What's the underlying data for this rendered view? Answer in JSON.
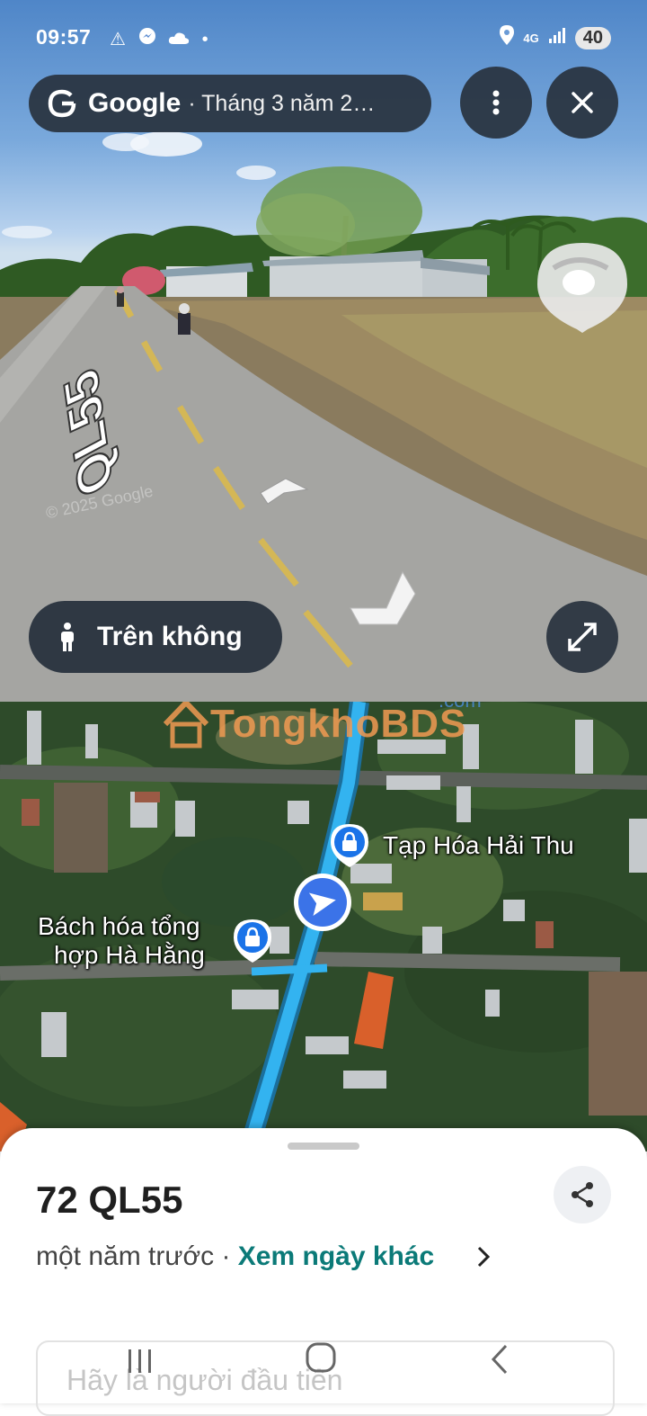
{
  "status_bar": {
    "time": "09:57",
    "left_icons": [
      "warning-icon",
      "messenger-icon",
      "cloud-icon",
      "dot-icon"
    ],
    "network": "4G",
    "battery": "40"
  },
  "header": {
    "brand": "Google",
    "date": "· Tháng 3 năm 2…"
  },
  "street_view": {
    "road_marking": "QL55",
    "copyright": "© 2025 Google",
    "aerial_label": "Trên không"
  },
  "map": {
    "watermark": "TongkhoBDS",
    "watermark_suffix": ".com",
    "pois": [
      {
        "name": "Tạp Hóa Hải Thu"
      },
      {
        "name_line1": "Bách hóa tổng",
        "name_line2": "hợp Hà Hằng"
      }
    ]
  },
  "sheet": {
    "title": "72 QL55",
    "time_ago": "một năm trước",
    "separator": " · ",
    "other_dates_link": "Xem ngày khác",
    "comment_placeholder": "Hãy là người đầu tiên"
  },
  "colors": {
    "route": "#33b3f0",
    "nav_blue": "#3b73e8",
    "link": "#0b7a78",
    "pill_bg": "#28323e"
  }
}
